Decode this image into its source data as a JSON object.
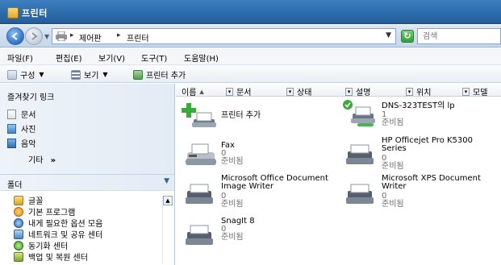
{
  "window": {
    "title": "프린터"
  },
  "address": {
    "crumbs": [
      "제어판",
      "프린터"
    ]
  },
  "search": {
    "placeholder": "검색"
  },
  "menu": [
    "파일(F)",
    "편집(E)",
    "보기(V)",
    "도구(T)",
    "도움말(H)"
  ],
  "toolbar": {
    "organize": "구성",
    "views": "보기",
    "add_printer": "프린터 추가"
  },
  "favorites": {
    "title": "즐겨찾기 링크",
    "items": [
      "문서",
      "사진",
      "음악"
    ],
    "more": "기타"
  },
  "folders": {
    "title": "폴더",
    "items": [
      "글꼴",
      "기본 프로그램",
      "내게 필요한 옵션 모음",
      "네트워크 및 공유 센터",
      "동기화 센터",
      "백업 및 복원 센터"
    ]
  },
  "columns": [
    "이름",
    "문서",
    "상태",
    "설명",
    "위치",
    "모델"
  ],
  "printers": [
    {
      "name": "프린터 추가",
      "count": "",
      "status": ""
    },
    {
      "name": "DNS-323TEST의 lp",
      "count": "1",
      "status": "준비됨"
    },
    {
      "name": "Fax",
      "count": "0",
      "status": "준비됨"
    },
    {
      "name": "HP Officejet Pro K5300 Series",
      "count": "0",
      "status": "준비됨"
    },
    {
      "name": "Microsoft Office Document Image Writer",
      "count": "0",
      "status": "준비됨"
    },
    {
      "name": "Microsoft XPS Document Writer",
      "count": "0",
      "status": "준비됨"
    },
    {
      "name": "SnagIt 8",
      "count": "0",
      "status": "준비됨"
    }
  ]
}
